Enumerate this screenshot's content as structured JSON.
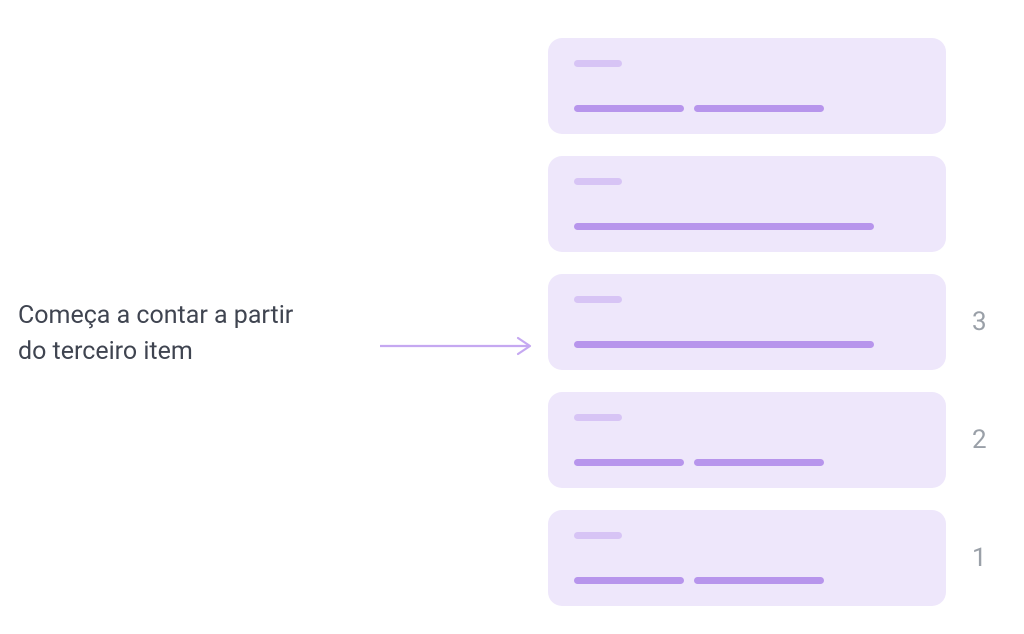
{
  "annotation": {
    "line1": "Começa a contar a partir",
    "line2": "do terceiro item"
  },
  "items": [
    {
      "number": "",
      "top_width": 48,
      "segments": [
        110,
        130
      ]
    },
    {
      "number": "",
      "top_width": 48,
      "segments": [
        300
      ]
    },
    {
      "number": "3",
      "top_width": 48,
      "segments": [
        300
      ]
    },
    {
      "number": "2",
      "top_width": 48,
      "segments": [
        110,
        130
      ]
    },
    {
      "number": "1",
      "top_width": 48,
      "segments": [
        110,
        130
      ]
    }
  ],
  "colors": {
    "card_bg": "#eee7fb",
    "bar_light": "#d7c4f5",
    "bar": "#b795ec",
    "text": "#3f4450",
    "number": "#9aa0a8",
    "arrow": "#c5a8f1"
  }
}
